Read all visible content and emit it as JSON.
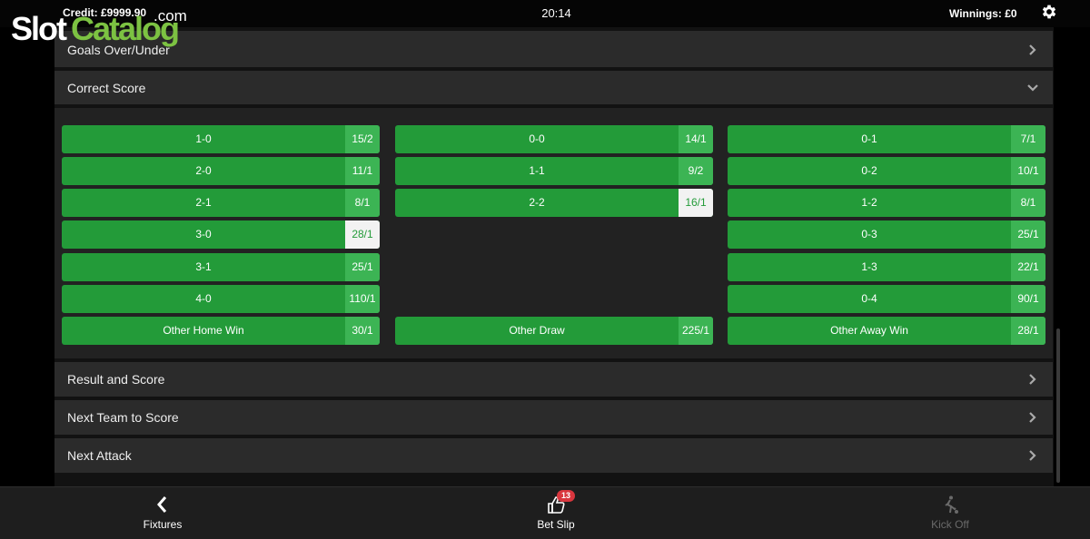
{
  "header": {
    "credit": "Credit:  £9999.90",
    "clock": "20:14",
    "winnings": "Winnings:  £0",
    "settings_icon": "gear-icon"
  },
  "watermark": {
    "part1": "Slot",
    "part2": "Catalog",
    "part3": ".com"
  },
  "sections": {
    "goals": "Goals Over/Under",
    "correct_score": "Correct Score",
    "result_score": "Result and Score",
    "next_team": "Next Team to Score",
    "next_attack": "Next Attack"
  },
  "correct_score": {
    "home": [
      {
        "score": "1-0",
        "odds": "15/2"
      },
      {
        "score": "2-0",
        "odds": "11/1"
      },
      {
        "score": "2-1",
        "odds": "8/1"
      },
      {
        "score": "3-0",
        "odds": "28/1"
      },
      {
        "score": "3-1",
        "odds": "25/1"
      },
      {
        "score": "4-0",
        "odds": "110/1"
      },
      {
        "score": "Other Home Win",
        "odds": "30/1"
      }
    ],
    "draw": [
      {
        "score": "0-0",
        "odds": "14/1"
      },
      {
        "score": "1-1",
        "odds": "9/2"
      },
      {
        "score": "2-2",
        "odds": "16/1"
      },
      {
        "score": "Other Draw",
        "odds": "225/1"
      }
    ],
    "away": [
      {
        "score": "0-1",
        "odds": "7/1"
      },
      {
        "score": "0-2",
        "odds": "10/1"
      },
      {
        "score": "1-2",
        "odds": "8/1"
      },
      {
        "score": "0-3",
        "odds": "25/1"
      },
      {
        "score": "1-3",
        "odds": "22/1"
      },
      {
        "score": "0-4",
        "odds": "90/1"
      },
      {
        "score": "Other Away Win",
        "odds": "28/1"
      }
    ]
  },
  "footer": {
    "fixtures": "Fixtures",
    "bet_slip": "Bet Slip",
    "bet_slip_count": "13",
    "kick_off": "Kick Off"
  },
  "colors": {
    "button_green": "#239b39",
    "odds_green": "#3cb454",
    "selected_odds_bg": "#f2f2f2",
    "badge_red": "#d9363e"
  }
}
